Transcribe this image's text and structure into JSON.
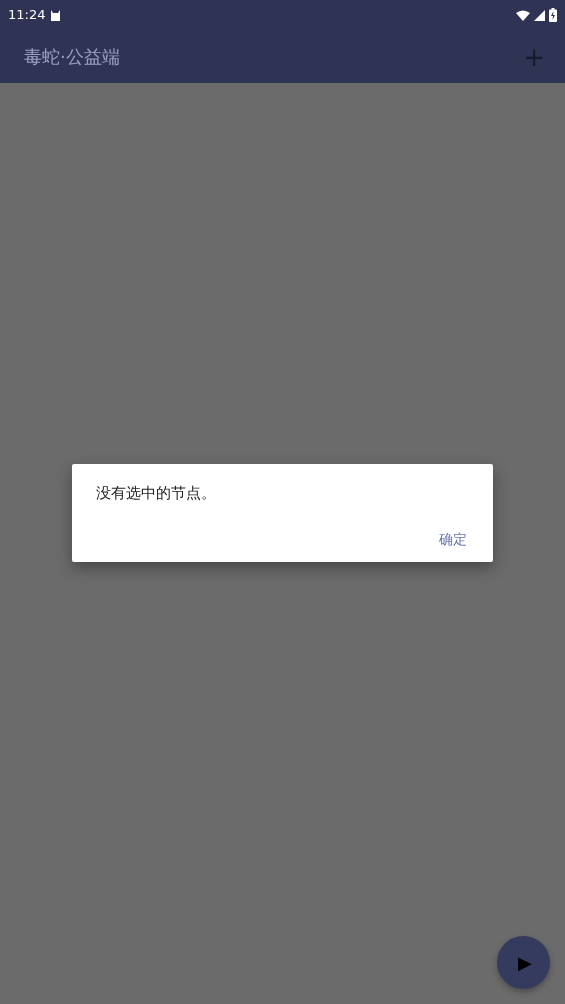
{
  "status_bar": {
    "time": "11:24"
  },
  "app_bar": {
    "title": "毒蛇·公益端",
    "action": "+"
  },
  "dialog": {
    "message": "没有选中的节点。",
    "button": "确定"
  },
  "fab": {
    "icon": "▶"
  }
}
